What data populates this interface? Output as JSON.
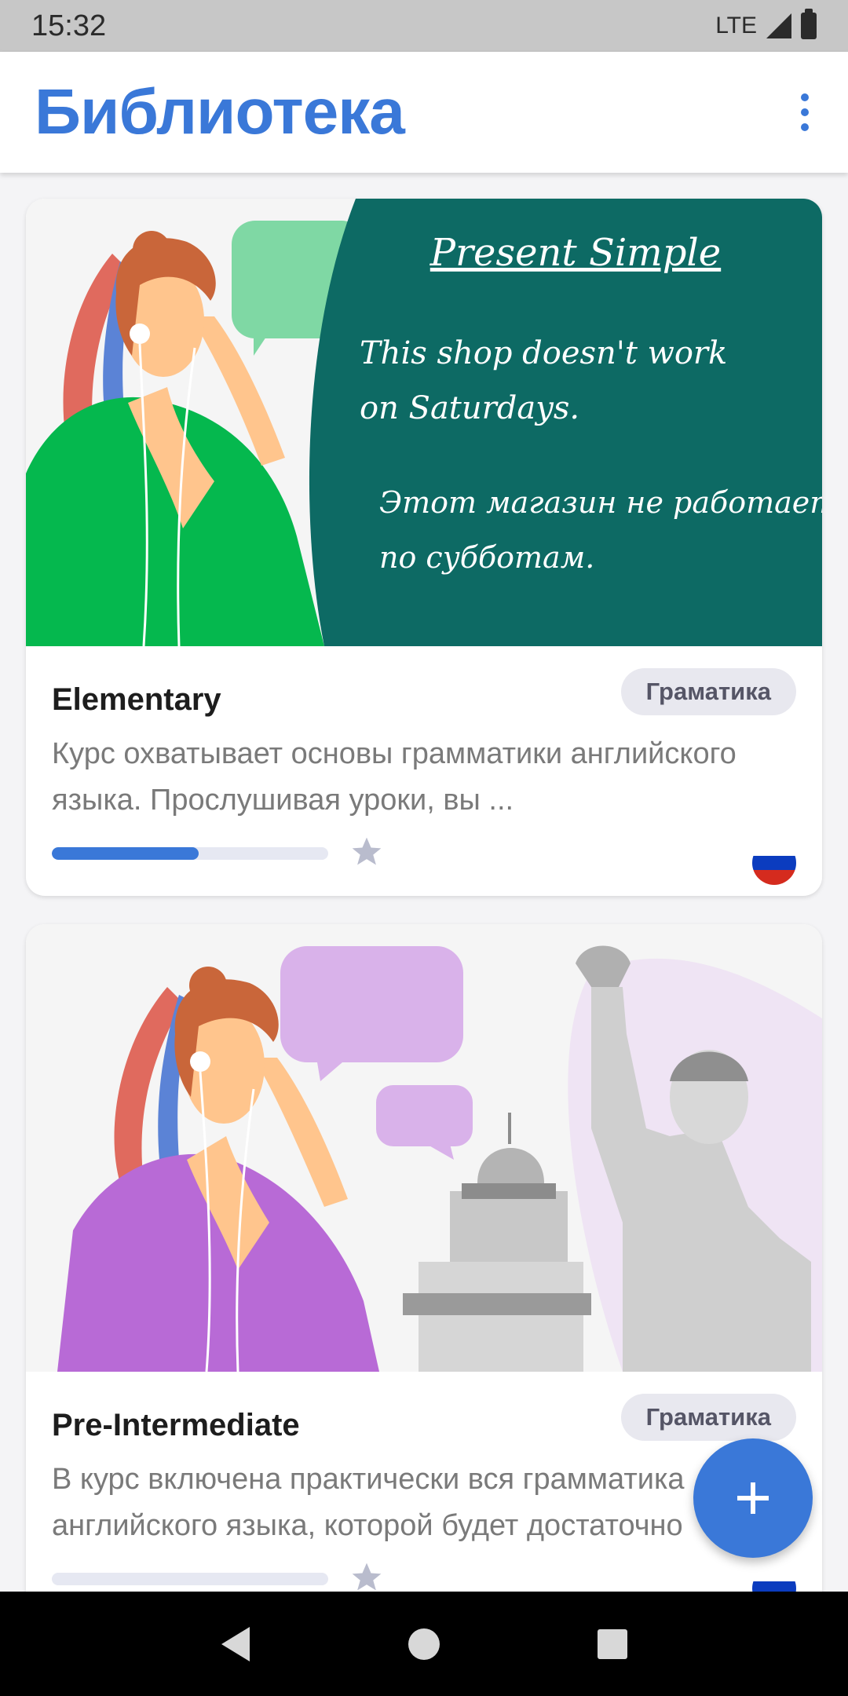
{
  "status_bar": {
    "time": "15:32",
    "network": "LTE"
  },
  "app_bar": {
    "title": "Библиотека"
  },
  "cards": [
    {
      "banner": {
        "heading": "Present Simple",
        "english": [
          "This shop doesn't work",
          "on Saturdays."
        ],
        "russian": [
          "Этот магазин не работает",
          "по субботам."
        ]
      },
      "title": "Elementary",
      "badge": "Граматика",
      "description": "Курс охватывает основы грамматики английского языка. Прослушивая уроки, вы ...",
      "progress": 0.53
    },
    {
      "title": "Pre-Intermediate",
      "badge": "Граматика",
      "description": "В курс включена практически вся грамматика английского языка, которой будет достаточно",
      "progress": 0.0
    }
  ],
  "colors": {
    "accent": "#3a78d8",
    "card1_banner": "#0d6a64",
    "card1_shirt": "#05b84e",
    "card2_shirt": "#b86ad6",
    "bubble_purple": "#d9b2ea"
  },
  "icons": [
    "more-vert-icon",
    "star-icon",
    "flag-ru-icon",
    "add-icon",
    "back-icon",
    "home-icon",
    "recents-icon"
  ]
}
